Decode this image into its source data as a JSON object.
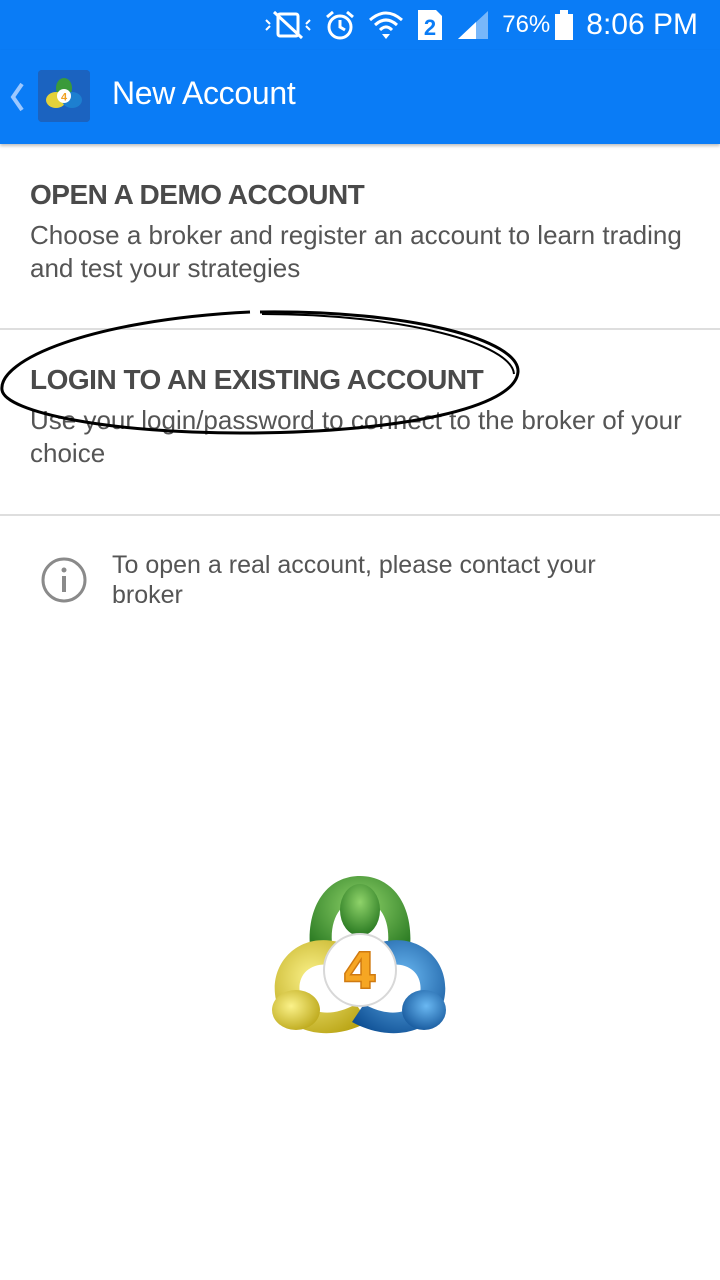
{
  "status_bar": {
    "battery_percent": "76%",
    "time": "8:06 PM",
    "sim_badge": "2",
    "icons": [
      "mute-vibrate-icon",
      "alarm-icon",
      "wifi-icon",
      "sim-2-icon",
      "signal-icon",
      "battery-icon"
    ]
  },
  "action_bar": {
    "back_icon": "chevron-left-icon",
    "app_icon": "metatrader-4-app-icon",
    "title": "New Account"
  },
  "options": [
    {
      "title": "OPEN A DEMO ACCOUNT",
      "description": "Choose a broker and register an account to learn trading and test your strategies"
    },
    {
      "title": "LOGIN TO AN EXISTING ACCOUNT",
      "description": "Use your login/password to connect to the broker of your choice"
    }
  ],
  "info": {
    "icon": "info-icon",
    "text": "To open a real account, please contact your broker"
  },
  "logo": {
    "icon": "metatrader-4-logo",
    "number": "4"
  },
  "colors": {
    "primary": "#0a7cf6",
    "title_text": "#4a4a4a",
    "body_text": "#555555",
    "divider": "#dedede"
  }
}
